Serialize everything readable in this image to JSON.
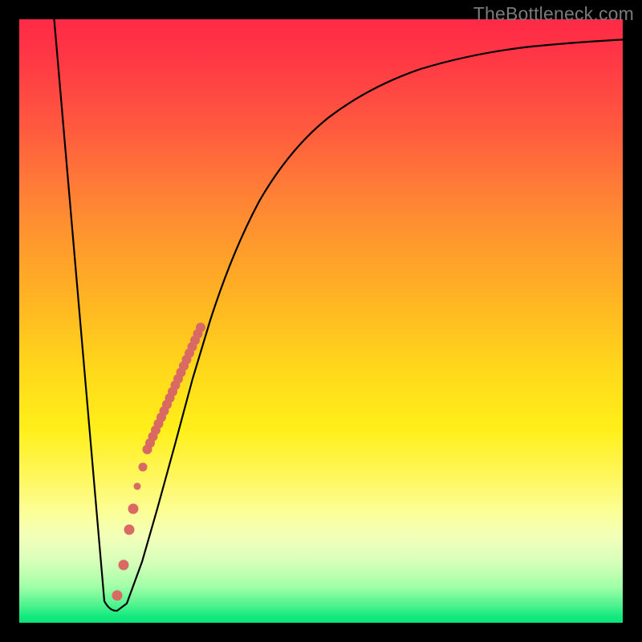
{
  "watermark": "TheBottleneck.com",
  "chart_data": {
    "type": "line",
    "title": "",
    "xlabel": "",
    "ylabel": "",
    "xlim": [
      0,
      100
    ],
    "ylim": [
      0,
      100
    ],
    "series": [
      {
        "name": "bottleneck-curve",
        "x": [
          5,
          8,
          10,
          13,
          15,
          17,
          19,
          21,
          23,
          25,
          28,
          32,
          36,
          40,
          46,
          54,
          62,
          72,
          84,
          100
        ],
        "y": [
          100,
          60,
          25,
          2,
          2,
          5,
          12,
          22,
          32,
          41,
          52,
          62,
          69,
          74,
          79,
          84,
          87,
          89.5,
          91,
          92.5
        ]
      }
    ],
    "highlighted_points": {
      "name": "red-dots",
      "x": [
        17.0,
        18.5,
        20.0,
        21.5,
        23.0,
        24.0,
        25.0,
        26.0,
        27.0,
        28.0,
        29.0,
        30.0,
        30.8,
        31.6,
        32.3
      ],
      "y": [
        5.0,
        10.0,
        17.0,
        24.0,
        31.0,
        36.0,
        41.0,
        45.0,
        49.0,
        52.0,
        55.0,
        58.0,
        60.0,
        62.0,
        63.5
      ]
    },
    "background": "heat-gradient red→yellow→green (value implied by vertical position; green=low, red=high)"
  }
}
